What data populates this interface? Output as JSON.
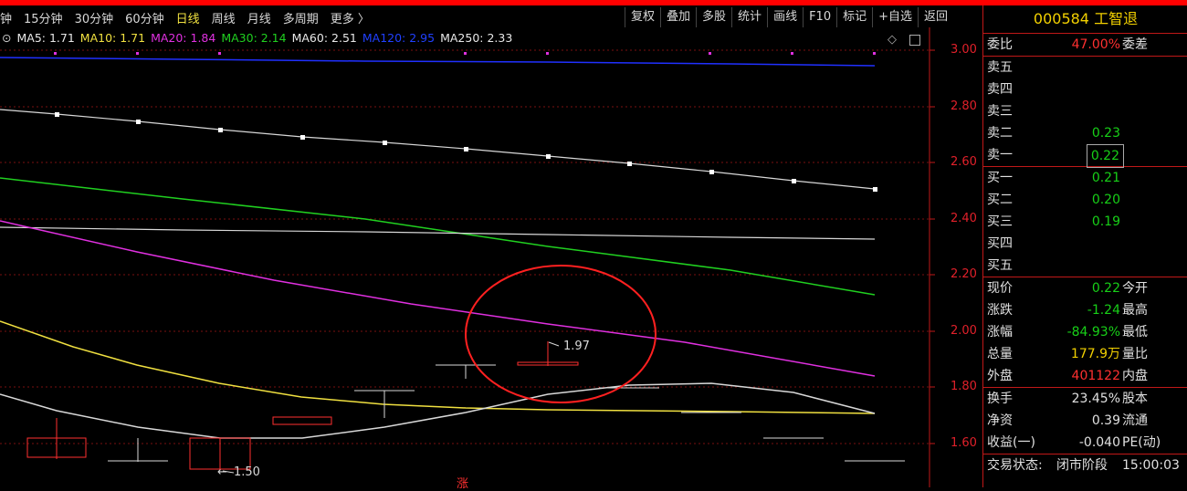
{
  "periods": [
    "钟",
    "15分钟",
    "30分钟",
    "60分钟",
    "日线",
    "周线",
    "月线",
    "多周期",
    "更多 〉"
  ],
  "active_period": "日线",
  "tools": [
    "复权",
    "叠加",
    "多股",
    "统计",
    "画线",
    "F10",
    "标记",
    "+自选",
    "返回"
  ],
  "ma": [
    {
      "label": "MA5: 1.71",
      "color": "#e8e8e8"
    },
    {
      "label": "MA10: 1.71",
      "color": "#f0e040"
    },
    {
      "label": "MA20: 1.84",
      "color": "#e030e0"
    },
    {
      "label": "MA30: 2.14",
      "color": "#20d020"
    },
    {
      "label": "MA60: 2.51",
      "color": "#e8e8e8"
    },
    {
      "label": "MA120: 2.95",
      "color": "#2040ff"
    },
    {
      "label": "MA250: 2.33",
      "color": "#e8e8e8"
    }
  ],
  "yaxis": [
    "3.00",
    "2.80",
    "2.60",
    "2.40",
    "2.20",
    "2.00",
    "1.80",
    "1.60"
  ],
  "annotations": {
    "high": "1.97",
    "low": "1.50",
    "bottom_mark": "涨"
  },
  "panel": {
    "title": "000584 工智退",
    "weibi_label": "委比",
    "weibi_value": "47.00%",
    "weicha_label": "委差",
    "asks": [
      {
        "label": "卖五",
        "value": ""
      },
      {
        "label": "卖四",
        "value": ""
      },
      {
        "label": "卖三",
        "value": ""
      },
      {
        "label": "卖二",
        "value": "0.23"
      },
      {
        "label": "卖一",
        "value": "0.22"
      }
    ],
    "bids": [
      {
        "label": "买一",
        "value": "0.21"
      },
      {
        "label": "买二",
        "value": "0.20"
      },
      {
        "label": "买三",
        "value": "0.19"
      },
      {
        "label": "买四",
        "value": ""
      },
      {
        "label": "买五",
        "value": ""
      }
    ],
    "quote": [
      {
        "label": "现价",
        "value": "0.22",
        "right": "今开",
        "color": "green"
      },
      {
        "label": "涨跌",
        "value": "-1.24",
        "right": "最高",
        "color": "green"
      },
      {
        "label": "涨幅",
        "value": "-84.93%",
        "right": "最低",
        "color": "green"
      },
      {
        "label": "总量",
        "value": "177.9万",
        "right": "量比",
        "color": "yellow"
      },
      {
        "label": "外盘",
        "value": "401122",
        "right": "内盘",
        "color": "red"
      }
    ],
    "extra": [
      {
        "label": "换手",
        "value": "23.45%",
        "right": "股本"
      },
      {
        "label": "净资",
        "value": "0.39",
        "right": "流通"
      },
      {
        "label": "收益(一)",
        "value": "-0.040",
        "right": "PE(动)"
      }
    ],
    "status_label": "交易状态:",
    "status_value": "闭市阶段",
    "status_time": "15:00:03"
  },
  "colors": {
    "up": "#ff3030",
    "down": "#18d018",
    "accent": "#f2d000",
    "frame": "#c01818"
  }
}
